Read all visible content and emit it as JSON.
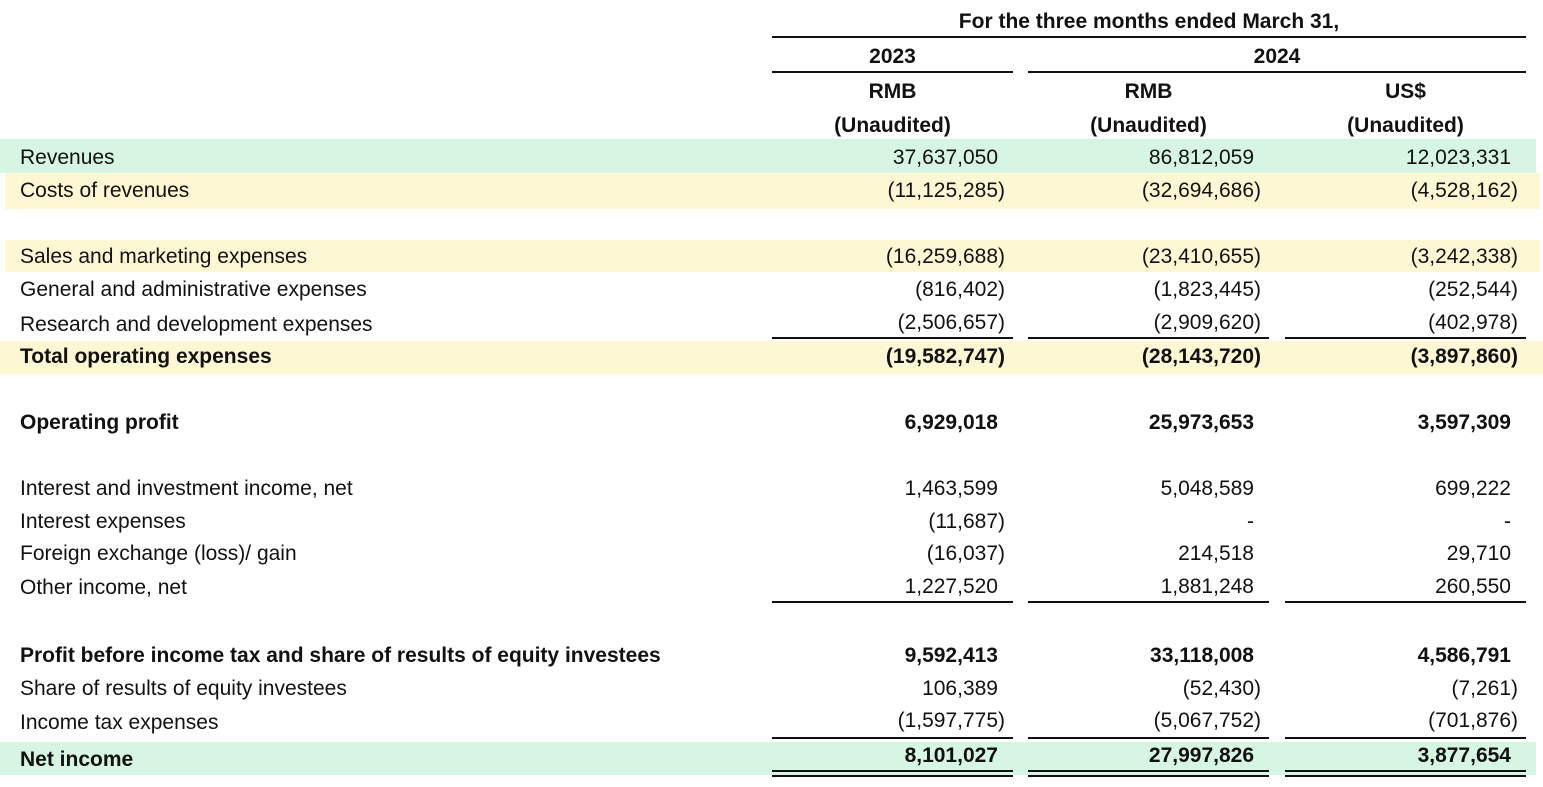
{
  "header": {
    "period_label": "For the three months ended March 31,",
    "year_2023": "2023",
    "year_2024": "2024",
    "col_currency": [
      "RMB",
      "RMB",
      "US$"
    ],
    "col_audit": [
      "(Unaudited)",
      "(Unaudited)",
      "(Unaudited)"
    ]
  },
  "rows": [
    {
      "label": "Revenues",
      "v1": "37,637,050",
      "v2": "86,812,059",
      "v3": "12,023,331"
    },
    {
      "label": "Costs of revenues",
      "v1": "(11,125,285)",
      "v2": "(32,694,686)",
      "v3": "(4,528,162)"
    },
    {
      "label": "Sales and marketing expenses",
      "v1": "(16,259,688)",
      "v2": "(23,410,655)",
      "v3": "(3,242,338)"
    },
    {
      "label": "General and administrative expenses",
      "v1": "(816,402)",
      "v2": "(1,823,445)",
      "v3": "(252,544)"
    },
    {
      "label": "Research and development expenses",
      "v1": "(2,506,657)",
      "v2": "(2,909,620)",
      "v3": "(402,978)"
    },
    {
      "label": "Total operating expenses",
      "v1": "(19,582,747)",
      "v2": "(28,143,720)",
      "v3": "(3,897,860)"
    },
    {
      "label": "Operating profit",
      "v1": "6,929,018",
      "v2": "25,973,653",
      "v3": "3,597,309"
    },
    {
      "label": "Interest and investment income, net",
      "v1": "1,463,599",
      "v2": "5,048,589",
      "v3": "699,222"
    },
    {
      "label": "Interest expenses",
      "v1": "(11,687)",
      "v2": "-",
      "v3": "-"
    },
    {
      "label": "Foreign exchange (loss)/ gain",
      "v1": "(16,037)",
      "v2": "214,518",
      "v3": "29,710"
    },
    {
      "label": "Other income, net",
      "v1": "1,227,520",
      "v2": "1,881,248",
      "v3": "260,550"
    },
    {
      "label": "Profit before income tax and share of results of equity investees",
      "v1": "9,592,413",
      "v2": "33,118,008",
      "v3": "4,586,791"
    },
    {
      "label": "Share of results of equity investees",
      "v1": "106,389",
      "v2": "(52,430)",
      "v3": "(7,261)"
    },
    {
      "label": "Income tax expenses",
      "v1": "(1,597,775)",
      "v2": "(5,067,752)",
      "v3": "(701,876)"
    },
    {
      "label": "Net income",
      "v1": "8,101,027",
      "v2": "27,997,826",
      "v3": "3,877,654"
    }
  ],
  "colors": {
    "highlight_green": "#d6f5e3",
    "highlight_yellow": "#fdf8d3",
    "text": "#111111"
  }
}
